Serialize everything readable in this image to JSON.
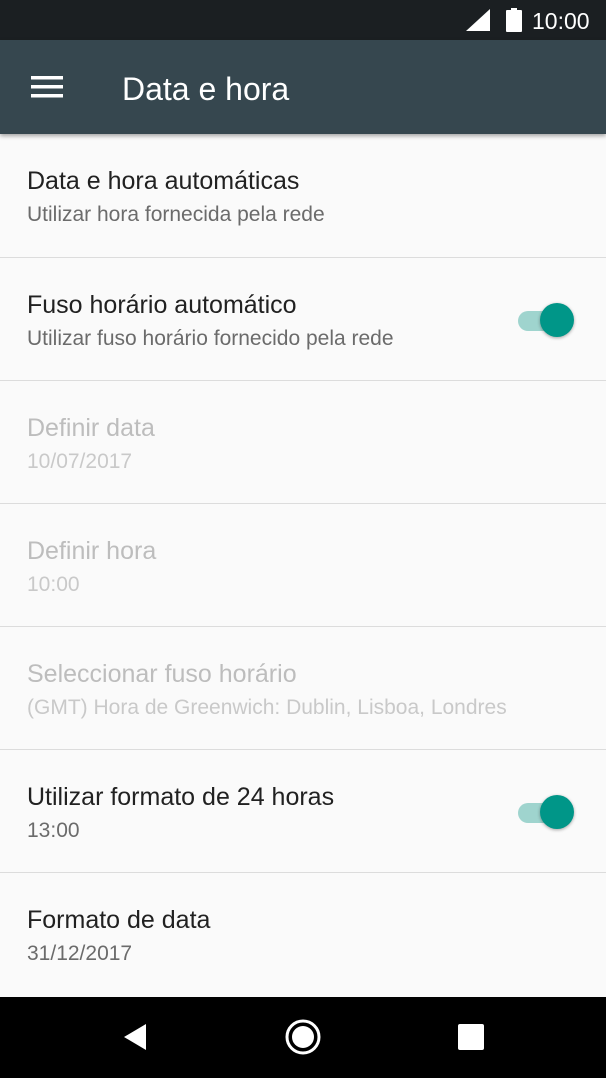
{
  "status_bar": {
    "time": "10:00",
    "icons": [
      "signal-icon",
      "battery-icon"
    ]
  },
  "app_bar": {
    "title": "Data e hora",
    "menu_icon": "menu-icon"
  },
  "settings": [
    {
      "title": "Data e hora automáticas",
      "subtitle": "Utilizar hora fornecida pela rede",
      "enabled": true,
      "toggle": null
    },
    {
      "title": "Fuso horário automático",
      "subtitle": "Utilizar fuso horário fornecido pela rede",
      "enabled": true,
      "toggle": true
    },
    {
      "title": "Definir data",
      "subtitle": "10/07/2017",
      "enabled": false,
      "toggle": null
    },
    {
      "title": "Definir hora",
      "subtitle": "10:00",
      "enabled": false,
      "toggle": null
    },
    {
      "title": "Seleccionar fuso horário",
      "subtitle": "(GMT) Hora de Greenwich: Dublin, Lisboa, Londres",
      "enabled": false,
      "toggle": null
    },
    {
      "title": "Utilizar formato de 24 horas",
      "subtitle": "13:00",
      "enabled": true,
      "toggle": true
    },
    {
      "title": "Formato de data",
      "subtitle": "31/12/2017",
      "enabled": true,
      "toggle": null
    }
  ],
  "colors": {
    "status_bar": "#1b1f22",
    "app_bar": "#36474f",
    "accent": "#009688",
    "toggle_track": "#9fd4ce",
    "background": "#fafafa"
  },
  "nav_bar": {
    "buttons": [
      "back-icon",
      "home-icon",
      "recents-icon"
    ]
  }
}
